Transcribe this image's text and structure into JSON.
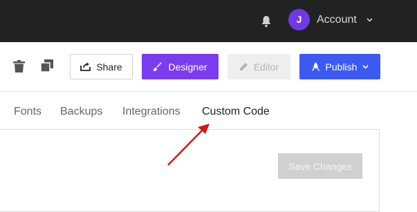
{
  "header": {
    "avatar_initial": "J",
    "account_label": "Account",
    "bg_color": "#222222"
  },
  "toolbar": {
    "share_label": "Share",
    "designer_label": "Designer",
    "editor_label": "Editor",
    "publish_label": "Publish"
  },
  "tabs": [
    {
      "label": "Fonts"
    },
    {
      "label": "Backups"
    },
    {
      "label": "Integrations"
    },
    {
      "label": "Custom Code"
    }
  ],
  "panel": {
    "save_label": "Save Changes"
  },
  "colors": {
    "designer": "#7b3cf0",
    "publish": "#3c5af2",
    "avatar": "#6d3ae6",
    "annotation_arrow": "#d81414"
  },
  "icons": [
    "bell-icon",
    "chevron-down-icon",
    "trash-icon",
    "duplicate-icon",
    "share-icon",
    "brush-icon",
    "pencil-icon",
    "rocket-icon"
  ]
}
